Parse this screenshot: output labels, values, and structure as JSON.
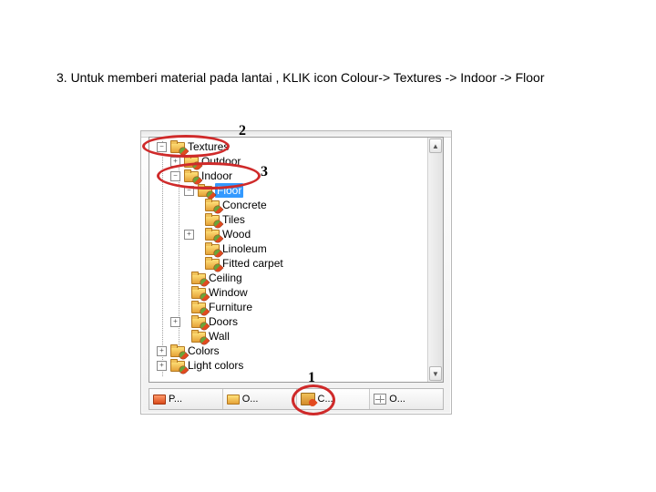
{
  "instruction": "3. Untuk memberi material pada lantai , KLIK icon Colour-> Textures -> Indoor -> Floor",
  "tree": {
    "textures": "Textures",
    "outdoor": "Outdoor",
    "indoor": "Indoor",
    "floor": "Floor",
    "floor_children": [
      "Concrete",
      "Tiles",
      "Wood",
      "Linoleum",
      "Fitted carpet"
    ],
    "indoor_rest": [
      "Ceiling",
      "Window",
      "Furniture",
      "Doors",
      "Wall"
    ],
    "colors": "Colors",
    "light_colors": "Light colors"
  },
  "tabs": [
    {
      "label": "P...",
      "icon": "folder-red"
    },
    {
      "label": "O...",
      "icon": "folder-yellow"
    },
    {
      "label": "C...",
      "icon": "texture"
    },
    {
      "label": "O...",
      "icon": "grid"
    }
  ],
  "annotations": {
    "a2": "2",
    "a3": "3",
    "a1": "1"
  },
  "scrollbar": {
    "up": "▲",
    "down": "▼"
  },
  "expand": {
    "plus": "+",
    "minus": "−"
  }
}
